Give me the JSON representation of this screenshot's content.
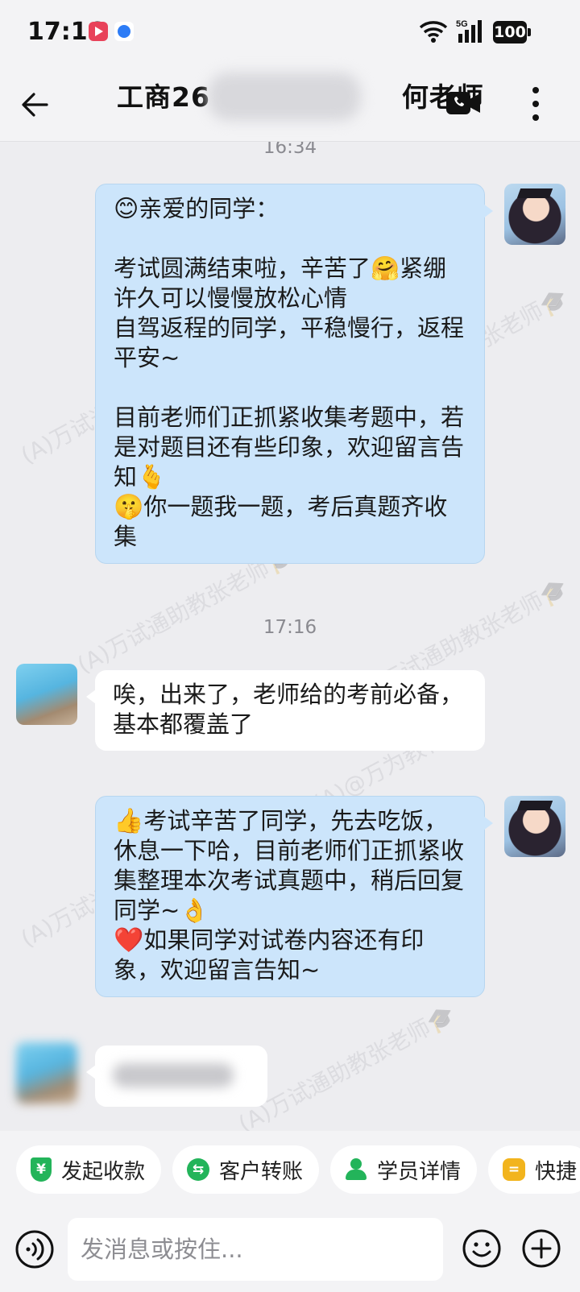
{
  "status_bar": {
    "time": "17:16",
    "signal_label": "5G",
    "battery": "100"
  },
  "header": {
    "title": "工商26　　　　　　　何老师",
    "back_icon": "back-arrow-icon",
    "video_icon": "video-call-icon",
    "more_icon": "more-vertical-icon"
  },
  "chat": {
    "watermark_text": "(A)万试通助教张老师🎓",
    "watermark_text_2": "(A)@万为教育",
    "messages": [
      {
        "type": "time",
        "text": "16:34"
      },
      {
        "type": "outgoing",
        "sender": "teacher",
        "lines": [
          {
            "emoji": "😊",
            "text": "亲爱的同学："
          },
          {
            "emoji": "",
            "text": ""
          },
          {
            "emoji": "",
            "text": "考试圆满结束啦，辛苦了🤗紧绷许久可以慢慢放松心情"
          },
          {
            "emoji": "",
            "text": "自驾返程的同学，平稳慢行，返程平安~"
          },
          {
            "emoji": "",
            "text": ""
          },
          {
            "emoji": "",
            "text": "目前老师们正抓紧收集考题中，若是对题目还有些印象，欢迎留言告知🫰"
          },
          {
            "emoji": "🤫",
            "text": "你一题我一题，考后真题齐收集"
          }
        ]
      },
      {
        "type": "time",
        "text": "17:16"
      },
      {
        "type": "incoming",
        "sender": "student",
        "text": "唉，出来了，老师给的考前必备，基本都覆盖了"
      },
      {
        "type": "outgoing",
        "sender": "teacher",
        "lines": [
          {
            "emoji": "👍",
            "text": "考试辛苦了同学，先去吃饭，休息一下哈，目前老师们正抓紧收集整理本次考试真题中，稍后回复同学~👌"
          },
          {
            "emoji": "❤️",
            "text": "如果同学对试卷内容还有印象，欢迎留言告知~"
          }
        ]
      },
      {
        "type": "incoming",
        "sender": "student",
        "text": ""
      }
    ]
  },
  "quick_actions": [
    {
      "label": "发起收款",
      "icon": "payment-shield-icon",
      "color": "#23b45a"
    },
    {
      "label": "客户转账",
      "icon": "transfer-icon",
      "color": "#23b45a"
    },
    {
      "label": "学员详情",
      "icon": "student-profile-icon",
      "color": "#23b45a"
    },
    {
      "label": "快捷",
      "icon": "quick-reply-icon",
      "color": "#f2b41d"
    }
  ],
  "input_bar": {
    "placeholder": "发消息或按住...",
    "voice_icon": "voice-icon",
    "emoji_icon": "emoji-icon",
    "plus_icon": "plus-icon"
  }
}
